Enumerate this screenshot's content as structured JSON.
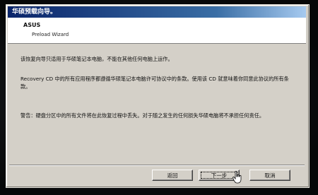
{
  "window": {
    "title": "华硕预载向导。"
  },
  "header": {
    "brand": "ASUS",
    "subtitle": "Preload Wizard"
  },
  "content": {
    "paragraph_1": "该恢复向导只适用于华硕笔记本电脑，不能在其他任何电脑上运作。",
    "paragraph_2": "Recovery CD 中的所有应用程序都遵循华硕笔记本电脑许可协议中的条款。使用该 CD 就意味着你同意此协议的所有条款。",
    "paragraph_3": "警告：硬盘分区中的所有文件将在此恢复过程中丢失。对于随之发生的任何损失华硕电脑将不承担任何责任。"
  },
  "buttons": {
    "back": "返回",
    "next": "下一步",
    "cancel": "取消"
  }
}
